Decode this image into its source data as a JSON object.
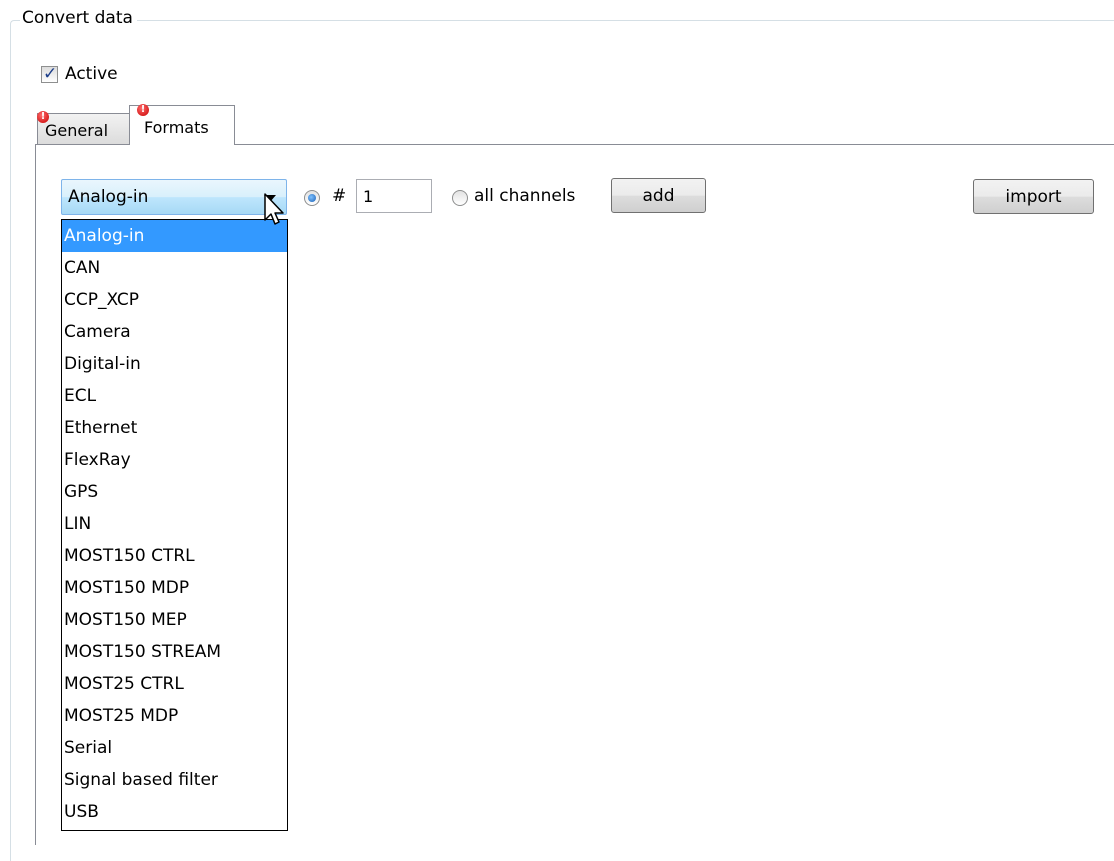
{
  "group": {
    "title": "Convert data"
  },
  "active_checkbox": {
    "label": "Active",
    "checked": true,
    "check_glyph": "✓"
  },
  "tabs": [
    {
      "label": "General",
      "selected": false,
      "error_icon": "error-icon"
    },
    {
      "label": "Formats",
      "selected": true,
      "error_icon": "error-icon"
    }
  ],
  "error_glyph": "!",
  "formats": {
    "source_combo": {
      "value": "Analog-in",
      "expanded": true
    },
    "channel_mode": {
      "selected": "number"
    },
    "hash_label": "#",
    "channel_number": "1",
    "all_channels_label": "all channels",
    "add_label": "add",
    "import_label": "import",
    "options": [
      "Analog-in",
      "CAN",
      "CCP_XCP",
      "Camera",
      "Digital-in",
      "ECL",
      "Ethernet",
      "FlexRay",
      "GPS",
      "LIN",
      "MOST150 CTRL",
      "MOST150 MDP",
      "MOST150 MEP",
      "MOST150 STREAM",
      "MOST25 CTRL",
      "MOST25 MDP",
      "Serial",
      "Signal based filter",
      "USB"
    ],
    "highlighted_option": "Analog-in"
  },
  "colors": {
    "selection": "#3399ff",
    "accent": "#1a5fb4",
    "error": "#c80000"
  }
}
